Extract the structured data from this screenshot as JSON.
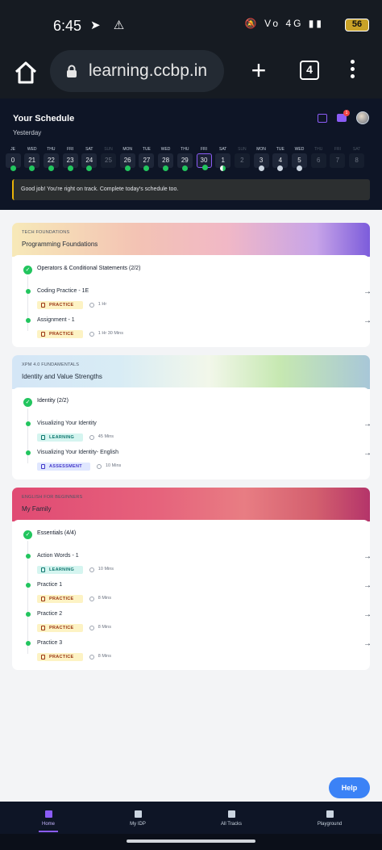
{
  "status_bar": {
    "time": "6:45",
    "network": "4G",
    "battery": "56"
  },
  "browser": {
    "url": "learning.ccbp.in",
    "tab_count": "4"
  },
  "schedule": {
    "title": "Your Schedule",
    "subtitle": "Yesterday",
    "notification_count": "1",
    "days": [
      {
        "name": "JE",
        "date": "0",
        "state": "done"
      },
      {
        "name": "WED",
        "date": "21",
        "state": "done"
      },
      {
        "name": "THU",
        "date": "22",
        "state": "done"
      },
      {
        "name": "FRI",
        "date": "23",
        "state": "done"
      },
      {
        "name": "SAT",
        "date": "24",
        "state": "done"
      },
      {
        "name": "SUN",
        "date": "25",
        "state": "future"
      },
      {
        "name": "MON",
        "date": "26",
        "state": "done"
      },
      {
        "name": "TUE",
        "date": "27",
        "state": "done"
      },
      {
        "name": "WED",
        "date": "28",
        "state": "done"
      },
      {
        "name": "THU",
        "date": "29",
        "state": "done"
      },
      {
        "name": "FRI",
        "date": "30",
        "state": "selected"
      },
      {
        "name": "SAT",
        "date": "1",
        "state": "partial"
      },
      {
        "name": "SUN",
        "date": "2",
        "state": "future"
      },
      {
        "name": "MON",
        "date": "3",
        "state": "locked"
      },
      {
        "name": "TUE",
        "date": "4",
        "state": "locked"
      },
      {
        "name": "WED",
        "date": "5",
        "state": "locked"
      },
      {
        "name": "THU",
        "date": "6",
        "state": "future"
      },
      {
        "name": "FRI",
        "date": "7",
        "state": "future"
      },
      {
        "name": "SAT",
        "date": "8",
        "state": "future"
      }
    ],
    "banner": "Good job! You're right on track. Complete today's schedule too."
  },
  "courses": [
    {
      "category": "TECH FOUNDATIONS",
      "name": "Programming Foundations",
      "module": "Operators & Conditional Statements (2/2)",
      "items": [
        {
          "title": "Coding Practice - 1E",
          "tag": "PRACTICE",
          "duration": "1 Hr"
        },
        {
          "title": "Assignment - 1",
          "tag": "PRACTICE",
          "duration": "1 Hr 30 Mins"
        }
      ]
    },
    {
      "category": "XPM 4.0 FUNDAMENTALS",
      "name": "Identity and Value Strengths",
      "module": "Identity (2/2)",
      "items": [
        {
          "title": "Visualizing Your Identity",
          "tag": "LEARNING",
          "duration": "45 Mins"
        },
        {
          "title": "Visualizing Your Identity- English",
          "tag": "ASSESSMENT",
          "duration": "10 Mins"
        }
      ]
    },
    {
      "category": "ENGLISH FOR BEGINNERS",
      "name": "My Family",
      "module": "Essentials (4/4)",
      "items": [
        {
          "title": "Action Words - 1",
          "tag": "LEARNING",
          "duration": "10 Mins"
        },
        {
          "title": "Practice 1",
          "tag": "PRACTICE",
          "duration": "8 Mins"
        },
        {
          "title": "Practice 2",
          "tag": "PRACTICE",
          "duration": "8 Mins"
        },
        {
          "title": "Practice 3",
          "tag": "PRACTICE",
          "duration": "8 Mins"
        }
      ]
    }
  ],
  "help_label": "Help",
  "nav": [
    {
      "label": "Home",
      "icon": "home-icon"
    },
    {
      "label": "My IDP",
      "icon": "idp-icon"
    },
    {
      "label": "All Tracks",
      "icon": "tracks-icon"
    },
    {
      "label": "Playground",
      "icon": "terminal-icon"
    }
  ],
  "colors": {
    "accent": "#8b5cf6",
    "success": "#22c55e",
    "help": "#3b82f6"
  }
}
